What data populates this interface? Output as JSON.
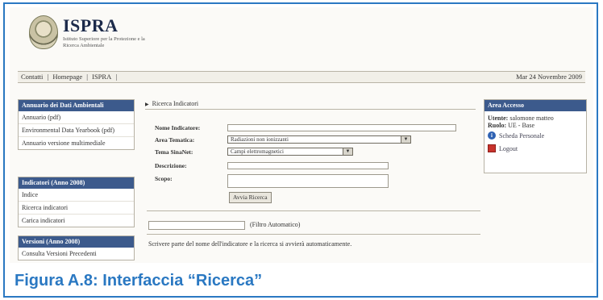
{
  "header": {
    "logo_title": "ISPRA",
    "logo_subtitle": "Istituto Superiore per la Protezione e la Ricerca Ambientale"
  },
  "topbar": {
    "links": [
      "Contatti",
      "|",
      "Homepage",
      "|",
      "ISPRA",
      "|"
    ],
    "date": "Mar 24 Novembre 2009"
  },
  "sidebar": {
    "box1": {
      "title": "Annuario dei Dati Ambientali",
      "items": [
        "Annuario (pdf)",
        "Environmental Data Yearbook (pdf)",
        "Annuario versione multimediale"
      ]
    },
    "box2": {
      "title": "Indicatori (Anno 2008)",
      "items": [
        "Indice",
        "Ricerca indicatori",
        "Carica indicatori"
      ]
    },
    "box3": {
      "title": "Versioni (Anno 2008)",
      "items": [
        "Consulta Versioni Precedenti"
      ]
    }
  },
  "access": {
    "title": "Area Accesso",
    "user_label": "Utente:",
    "user_value": "salomone matteo",
    "role_label": "Ruolo:",
    "role_value": "UE - Base",
    "profile_link": "Scheda Personale",
    "logout_link": "Logout"
  },
  "search": {
    "heading": "Ricerca Indicatori",
    "fields": {
      "nome": "Nome Indicatore:",
      "area": "Area Tematica:",
      "tema": "Tema SinaNet:",
      "descrizione": "Descrizione:",
      "scopo": "Scopo:"
    },
    "area_selected": "Radiazioni non ionizzanti",
    "tema_selected": "Campi elettromagnetici",
    "button": "Avvia Ricerca",
    "filter_label": "(Filtro Automatico)",
    "hint": "Scrivere parte del nome dell'indicatore e la ricerca si avvierà automaticamente."
  },
  "caption": "Figura A.8: Interfaccia “Ricerca”"
}
